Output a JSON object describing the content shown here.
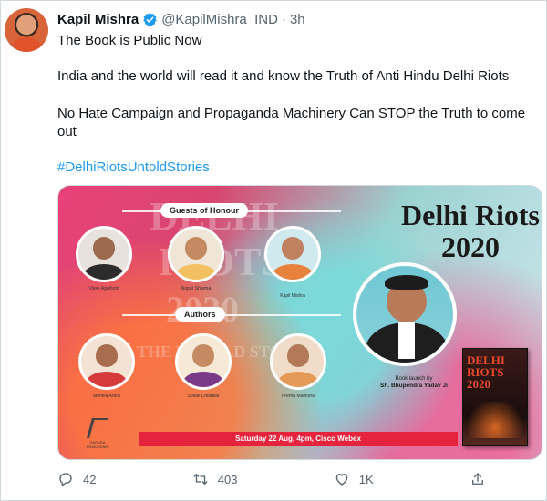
{
  "author": {
    "name": "Kapil Mishra",
    "handle": "@KapilMishra_IND",
    "separator": "·",
    "time": "3h"
  },
  "tweet": {
    "line1": "The Book is Public Now",
    "line2": "India and the world will read it and know the Truth of Anti Hindu Delhi Riots",
    "line3": "No Hate Campaign and Propaganda Machinery Can STOP the Truth to come out",
    "hashtag": "#DelhiRiotsUntoldStories"
  },
  "poster": {
    "guests_pill": "Guests of Honour",
    "authors_pill": "Authors",
    "headline_1": "Delhi Riots",
    "headline_2": "2020",
    "guests": [
      {
        "caption": "Vivek Agnihotri"
      },
      {
        "caption": "Nupur Sharma"
      },
      {
        "caption": "Kapil Mishra"
      }
    ],
    "authors": [
      {
        "caption": "Monika Arora"
      },
      {
        "caption": "Sonali Chitalkar"
      },
      {
        "caption": "Prerna Malhotra"
      }
    ],
    "launch_line_1": "Book launch by",
    "launch_line_2": "Sh. Bhupendra Yadav Ji",
    "banner": "Saturday 22 Aug, 4pm, Cisco Webex",
    "book_title_1": "DELHI",
    "book_title_2": "RIOTS",
    "book_title_3": "2020",
    "publisher": "GARUDA PRAKASHAN",
    "ghost_1": "DELHI",
    "ghost_2": "RIOTS",
    "ghost_3": "2020",
    "ghost_4": "THE UNTOLD STORY"
  },
  "actions": {
    "replies": "42",
    "retweets": "403",
    "likes": "1K"
  },
  "colors": {
    "link": "#1d9bf0",
    "verified": "#1d9bf0",
    "muted": "#536471",
    "banner": "#e5233d"
  }
}
